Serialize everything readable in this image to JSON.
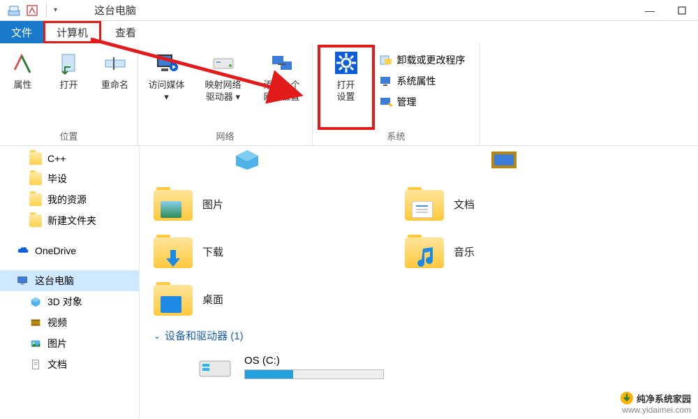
{
  "titlebar": {
    "title": "这台电脑"
  },
  "tabs": {
    "file": "文件",
    "computer": "计算机",
    "view": "查看"
  },
  "ribbon": {
    "location": {
      "label": "位置",
      "props": "属性",
      "open": "打开",
      "rename": "重命名"
    },
    "network": {
      "label": "网络",
      "media": "访问媒体",
      "map_drive_l1": "映射网络",
      "map_drive_l2": "驱动器",
      "add_loc_l1": "添加一个",
      "add_loc_l2": "网络位置"
    },
    "system": {
      "label": "系统",
      "open_settings_l1": "打开",
      "open_settings_l2": "设置",
      "uninstall": "卸载或更改程序",
      "sysprops": "系统属性",
      "manage": "管理"
    }
  },
  "sidebar": {
    "items": [
      {
        "label": "C++",
        "type": "folder"
      },
      {
        "label": "毕设",
        "type": "folder"
      },
      {
        "label": "我的资源",
        "type": "folder"
      },
      {
        "label": "新建文件夹",
        "type": "folder"
      }
    ],
    "onedrive": "OneDrive",
    "thispc": "这台电脑",
    "pc_children": [
      {
        "label": "3D 对象"
      },
      {
        "label": "视频"
      },
      {
        "label": "图片"
      },
      {
        "label": "文档"
      }
    ]
  },
  "content": {
    "folders": [
      {
        "label": "图片",
        "inner": "pic"
      },
      {
        "label": "文档",
        "inner": "doc"
      },
      {
        "label": "下载",
        "inner": "dl"
      },
      {
        "label": "音乐",
        "inner": "music"
      },
      {
        "label": "桌面",
        "inner": "desk"
      }
    ],
    "section": "设备和驱动器 (1)",
    "drive": {
      "label": "OS (C:)"
    }
  },
  "watermark": {
    "brand": "纯净系统家园",
    "url": "www.yidaimei.com"
  }
}
